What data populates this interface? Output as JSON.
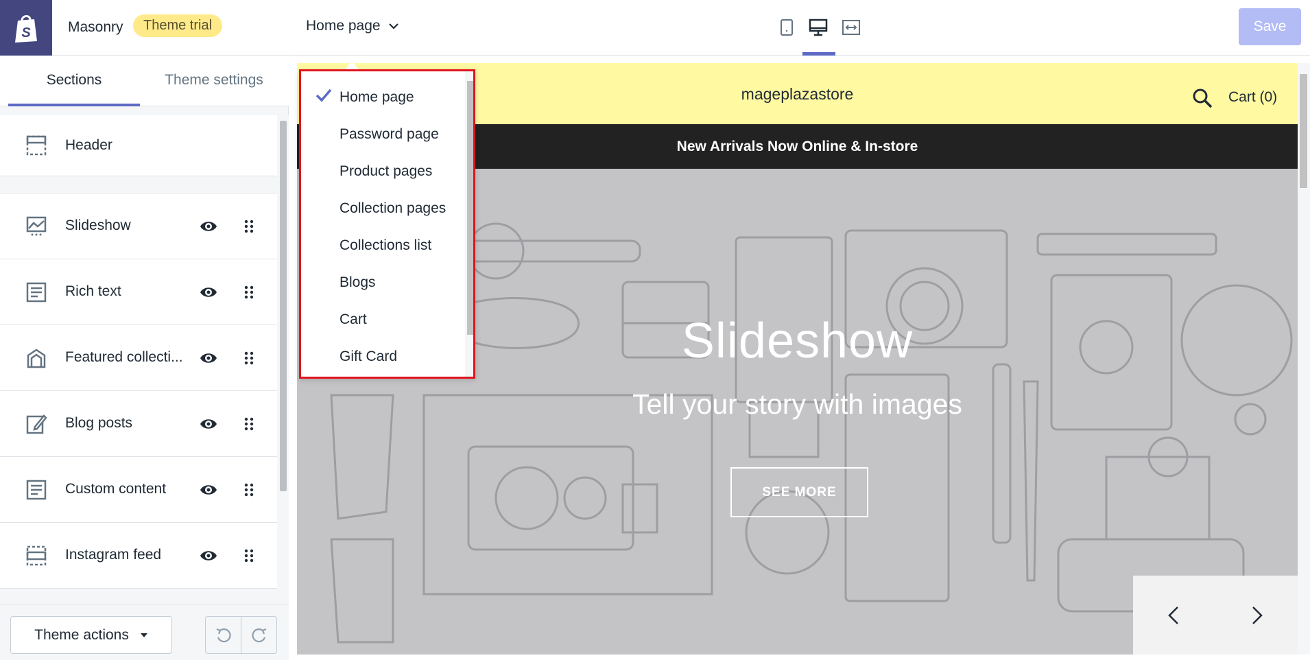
{
  "app": {
    "theme_name": "Masonry",
    "trial_badge": "Theme trial",
    "brand_color": "#43467f",
    "accent_color": "#5c6ac4"
  },
  "sidebar": {
    "tabs": [
      {
        "label": "Sections",
        "active": true
      },
      {
        "label": "Theme settings",
        "active": false
      }
    ],
    "sections": [
      {
        "label": "Header",
        "icon": "header-layout-icon",
        "visible_toggle": false,
        "draggable": false
      },
      {
        "label": "Slideshow",
        "icon": "slideshow-icon",
        "visible_toggle": true,
        "draggable": true
      },
      {
        "label": "Rich text",
        "icon": "text-block-icon",
        "visible_toggle": true,
        "draggable": true
      },
      {
        "label": "Featured collecti...",
        "icon": "collection-icon",
        "visible_toggle": true,
        "draggable": true
      },
      {
        "label": "Blog posts",
        "icon": "blog-edit-icon",
        "visible_toggle": true,
        "draggable": true
      },
      {
        "label": "Custom content",
        "icon": "text-block-icon",
        "visible_toggle": true,
        "draggable": true
      },
      {
        "label": "Instagram feed",
        "icon": "footer-layout-icon",
        "visible_toggle": true,
        "draggable": true
      }
    ],
    "footer": {
      "theme_actions_label": "Theme actions",
      "undo_icon": "undo-icon",
      "redo_icon": "redo-icon"
    }
  },
  "topbar": {
    "page_selector_label": "Home page",
    "views": [
      "mobile-view-icon",
      "desktop-view-icon",
      "fullscreen-view-icon"
    ],
    "active_view": "desktop",
    "save_label": "Save"
  },
  "page_dropdown": {
    "selected": "Home page",
    "items": [
      "Home page",
      "Password page",
      "Product pages",
      "Collection pages",
      "Collections list",
      "Blogs",
      "Cart",
      "Gift Card"
    ],
    "highlight_border_color": "#e0141e"
  },
  "preview": {
    "store_name": "mageplazastore",
    "cart_label": "Cart (0)",
    "announcement": "New Arrivals Now Online & In-store",
    "header_bg": "#fff9a1",
    "hero": {
      "title": "Slideshow",
      "subtitle": "Tell your story with images",
      "cta_label": "SEE MORE"
    }
  }
}
